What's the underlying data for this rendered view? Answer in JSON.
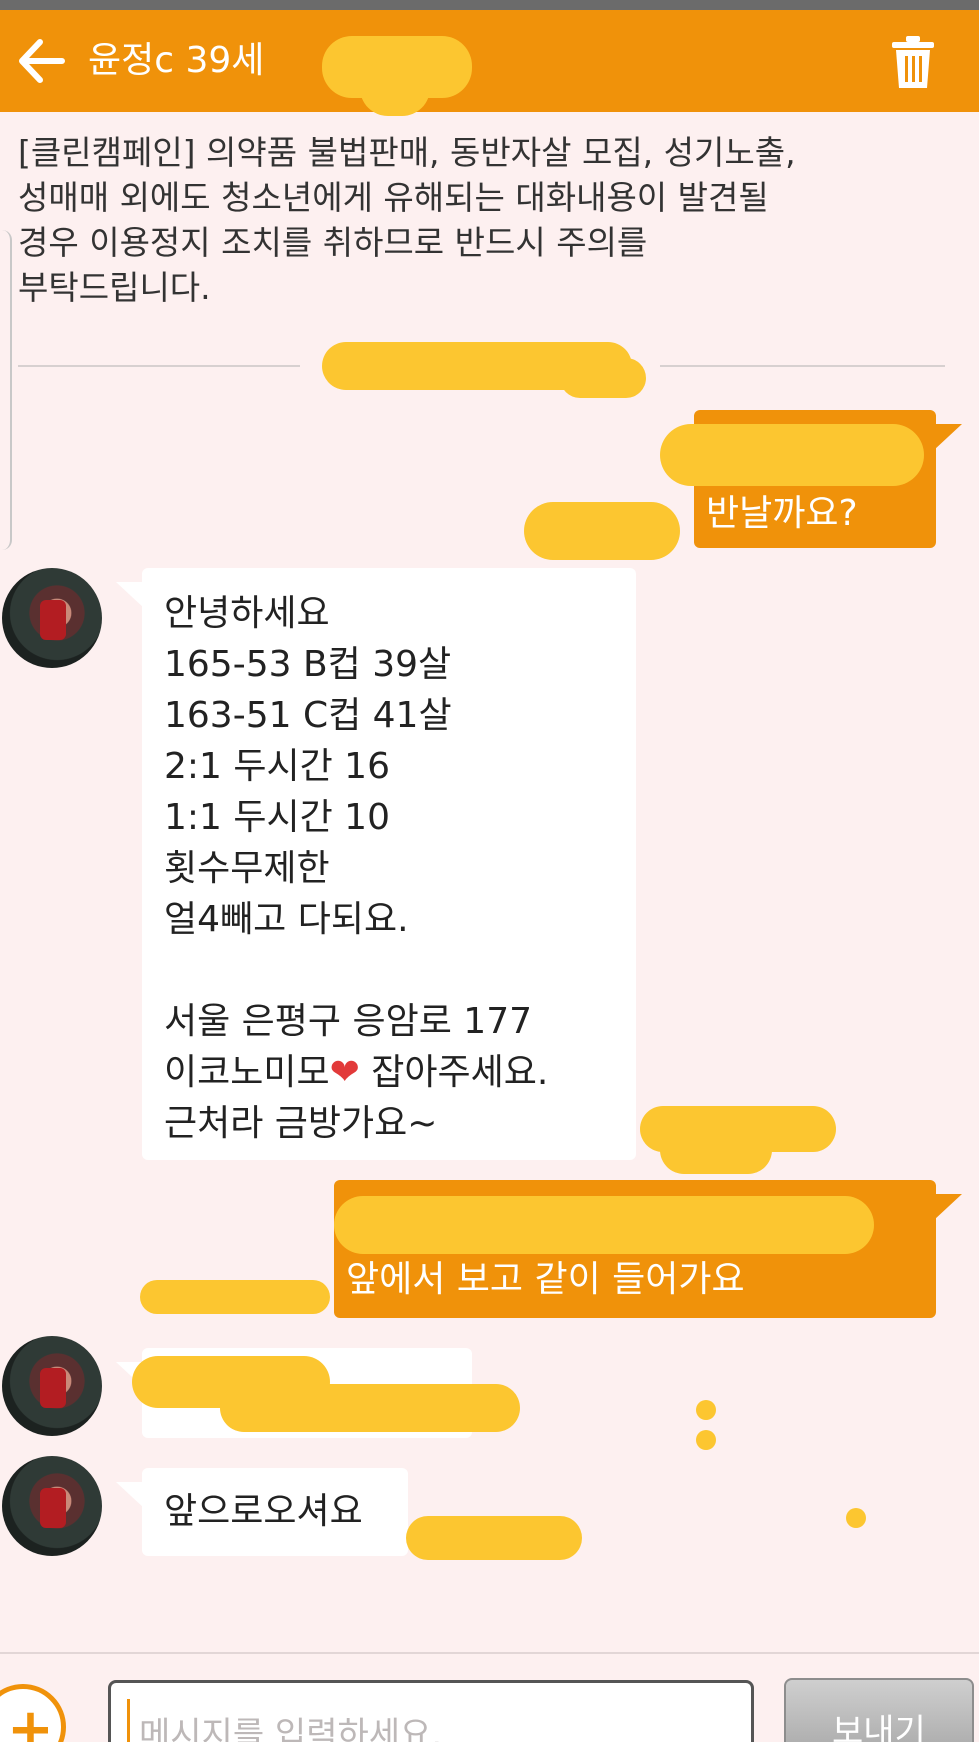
{
  "header": {
    "title": "윤정c 39세",
    "back_icon": "arrow-left-icon",
    "trash_icon": "trash-icon",
    "accent": "#f0920a"
  },
  "notice": {
    "lines": [
      "[클린캠페인] 의약품 불법판매, 동반자살 모집, 성기노출,",
      "성매매 외에도 청소년에게 유해되는 대화내용이 발견될",
      "경우 이용정지 조치를 취하므로 반드시 주의를",
      "부탁드립니다."
    ]
  },
  "messages": {
    "out1": {
      "visible_text": "반날까요?"
    },
    "in1": {
      "lines": [
        "안녕하세요",
        "165-53 B컵 39살",
        "163-51 C컵 41살",
        "2:1 두시간 16",
        "1:1 두시간 10",
        "횟수무제한",
        "얼4빼고 다되요.",
        "",
        "서울 은평구 응암로 177",
        "이코노미모",
        "근처라 금방가요~"
      ],
      "heart": "❤",
      "after_heart": " 잡아주세요."
    },
    "out2": {
      "visible_text": "앞에서 보고 같이 들어가요"
    },
    "in3": {
      "text": "앞으로오셔요"
    }
  },
  "input": {
    "placeholder": "메시지를 입력하세요.",
    "send_label": "보내기",
    "plus_icon": "plus-icon"
  },
  "colors": {
    "background": "#fdf0f0",
    "outgoing_bubble": "#f0920a",
    "incoming_bubble": "#ffffff",
    "redaction": "#fcc630"
  }
}
